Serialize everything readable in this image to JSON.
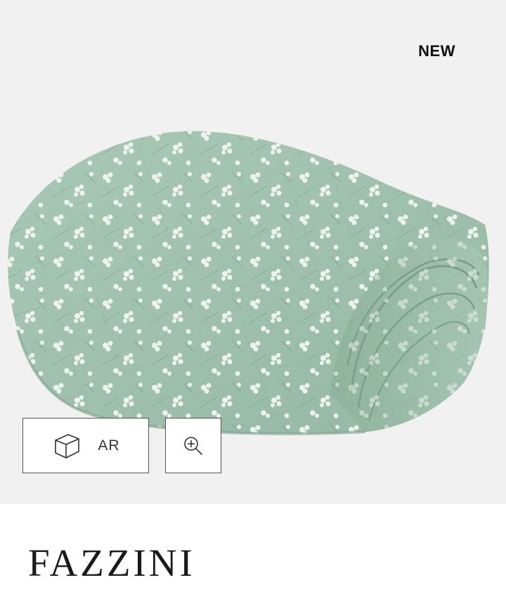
{
  "product": {
    "badge": "NEW",
    "image_icon": "folded-quilt-image",
    "fabric_color": "#9ec1ad",
    "flower_color": "#f4f7f3"
  },
  "actions": {
    "ar_label": "AR",
    "ar_icon": "cube-icon",
    "zoom_icon": "zoom-in-icon"
  },
  "brand": {
    "logo": "FAZZINI"
  }
}
